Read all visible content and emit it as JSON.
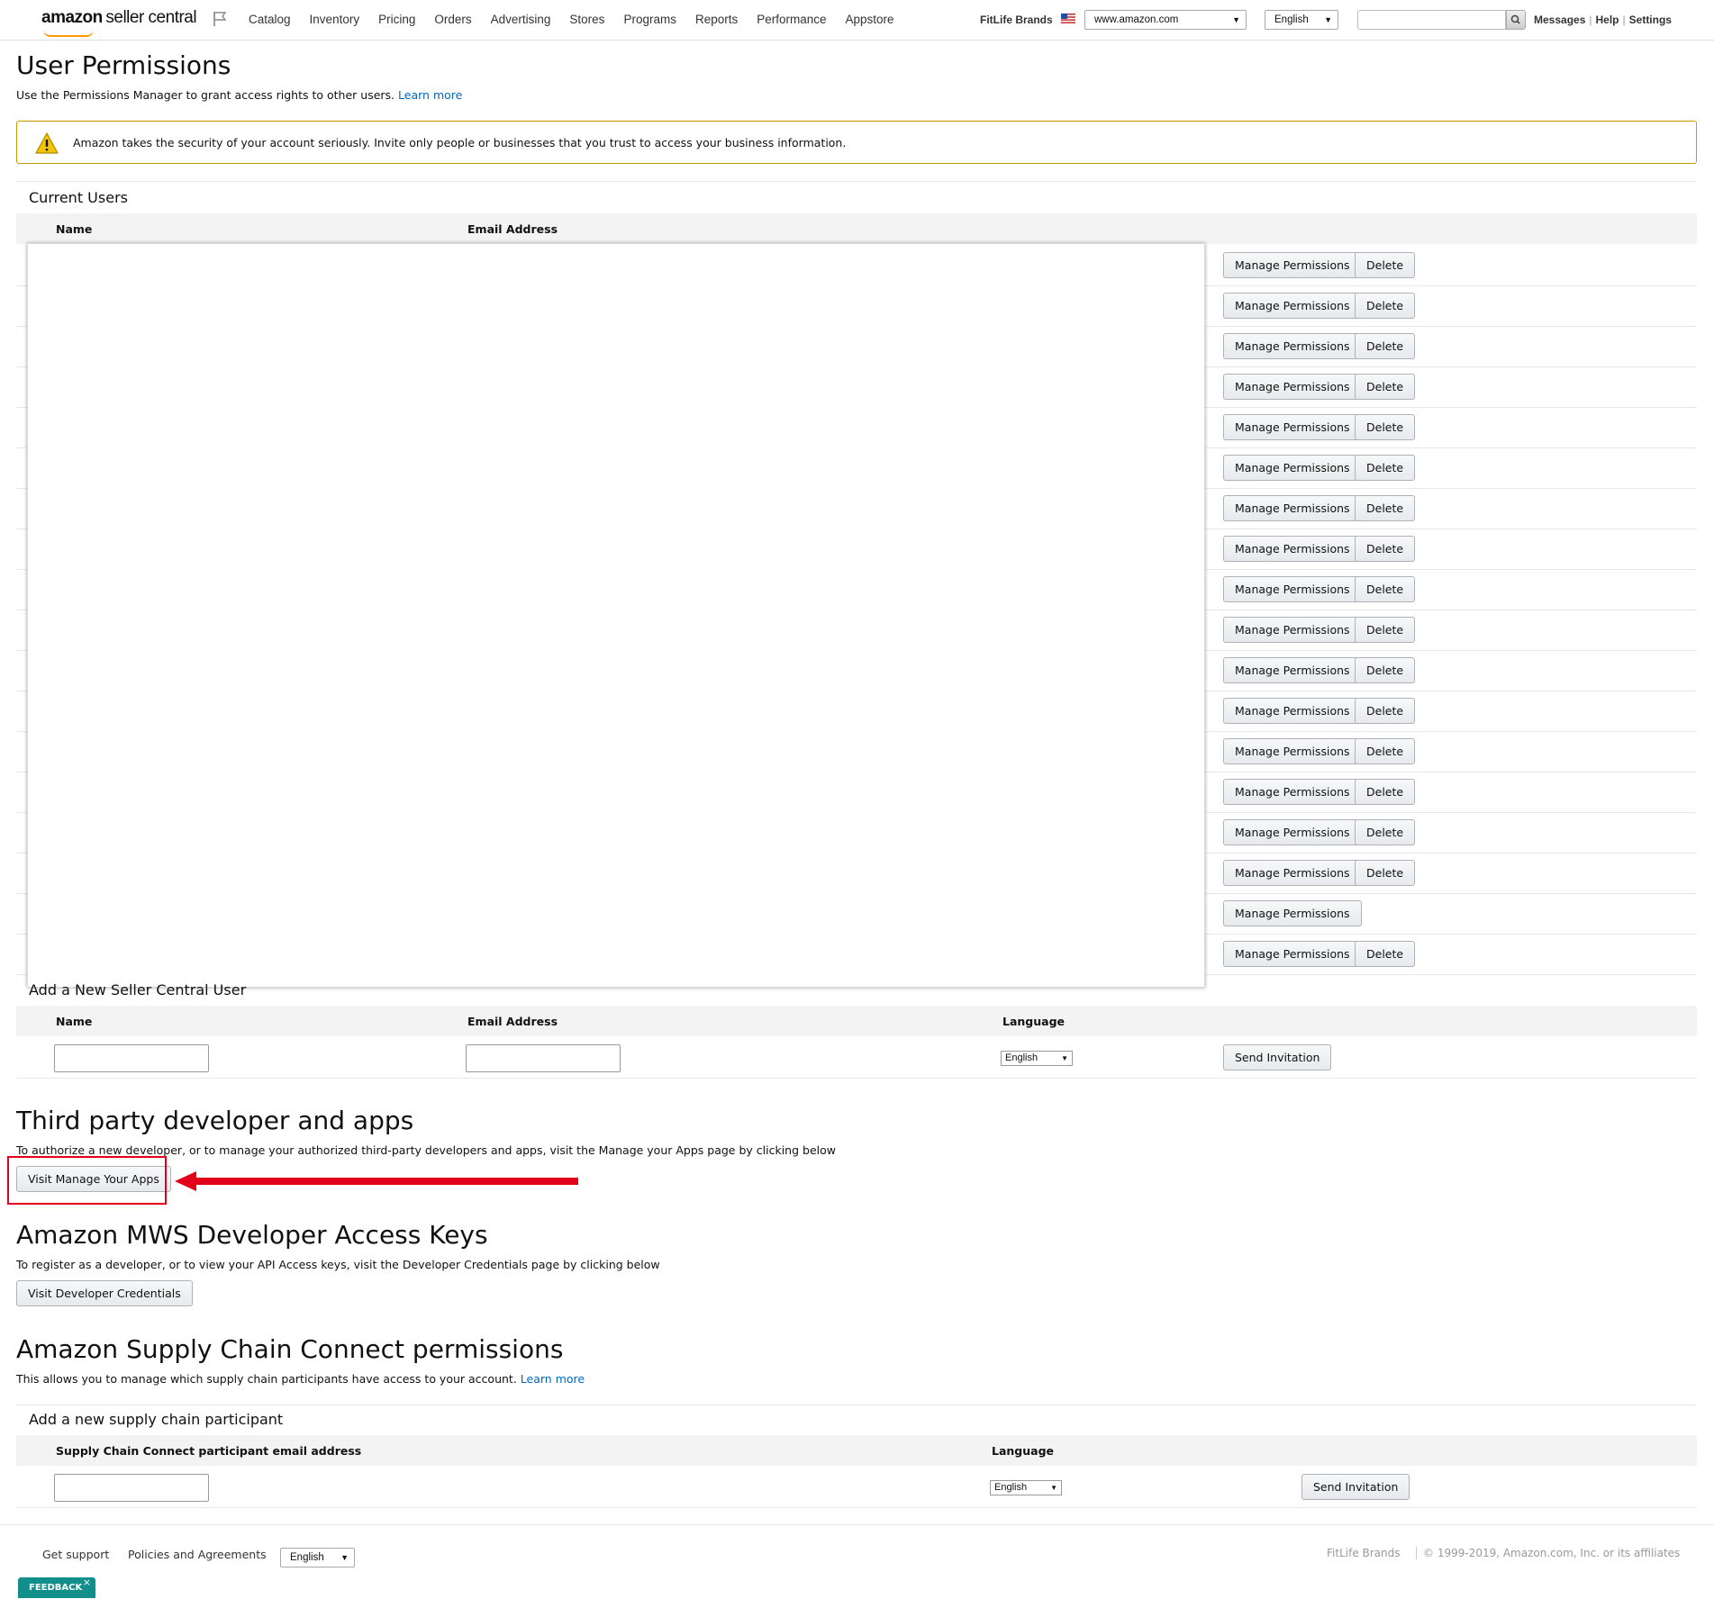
{
  "nav": {
    "logo_amazon": "amazon",
    "logo_rest": "seller central",
    "links": [
      "Catalog",
      "Inventory",
      "Pricing",
      "Orders",
      "Advertising",
      "Stores",
      "Programs",
      "Reports",
      "Performance",
      "Appstore"
    ],
    "brand": "FitLife Brands",
    "marketplace": "www.amazon.com",
    "language": "English",
    "search_value": "",
    "messages": "Messages",
    "help": "Help",
    "settings": "Settings",
    "separator": "|"
  },
  "page": {
    "title": "User Permissions",
    "description": "Use the Permissions Manager to grant access rights to other users.",
    "learn_more": "Learn more"
  },
  "alert": {
    "text": "Amazon takes the security of your account seriously. Invite only people or businesses that you trust to access your business information."
  },
  "current_users": {
    "heading": "Current Users",
    "columns": {
      "name": "Name",
      "email": "Email Address"
    },
    "manage_label": "Manage Permissions",
    "delete_label": "Delete",
    "rows": [
      {
        "has_delete": true
      },
      {
        "has_delete": true
      },
      {
        "has_delete": true
      },
      {
        "has_delete": true
      },
      {
        "has_delete": true
      },
      {
        "has_delete": true
      },
      {
        "has_delete": true
      },
      {
        "has_delete": true
      },
      {
        "has_delete": true
      },
      {
        "has_delete": true
      },
      {
        "has_delete": true
      },
      {
        "has_delete": true
      },
      {
        "has_delete": true
      },
      {
        "has_delete": true
      },
      {
        "has_delete": true
      },
      {
        "has_delete": true
      },
      {
        "has_delete": false
      },
      {
        "has_delete": true
      }
    ]
  },
  "add_user": {
    "heading": "Add a New Seller Central User",
    "columns": {
      "name": "Name",
      "email": "Email Address",
      "language": "Language"
    },
    "name_value": "",
    "email_value": "",
    "language": "English",
    "send_label": "Send Invitation"
  },
  "third_party": {
    "heading": "Third party developer and apps",
    "description": "To authorize a new developer, or to manage your authorized third-party developers and apps, visit the Manage your Apps page by clicking below",
    "button": "Visit Manage Your Apps",
    "highlight_color": "#e3001b"
  },
  "mws": {
    "heading": "Amazon MWS Developer Access Keys",
    "description": "To register as a developer, or to view your API Access keys, visit the Developer Credentials page by clicking below",
    "button": "Visit Developer Credentials"
  },
  "supply_chain": {
    "heading": "Amazon Supply Chain Connect permissions",
    "description": "This allows you to manage which supply chain participants have access to your account.",
    "learn_more": "Learn more",
    "subheading": "Add a new supply chain participant",
    "columns": {
      "email": "Supply Chain Connect participant email address",
      "language": "Language"
    },
    "email_value": "",
    "language": "English",
    "send_label": "Send Invitation"
  },
  "footer": {
    "get_support": "Get support",
    "policies": "Policies and Agreements",
    "language": "English",
    "brand": "FitLife Brands",
    "copyright": "© 1999-2019, Amazon.com, Inc. or its affiliates",
    "feedback": "FEEDBACK",
    "feedback_close": "×"
  },
  "colors": {
    "link": "#0066c0",
    "accent": "#ff9900",
    "feedback": "#128f8b",
    "alert_border": "#c79a00"
  }
}
